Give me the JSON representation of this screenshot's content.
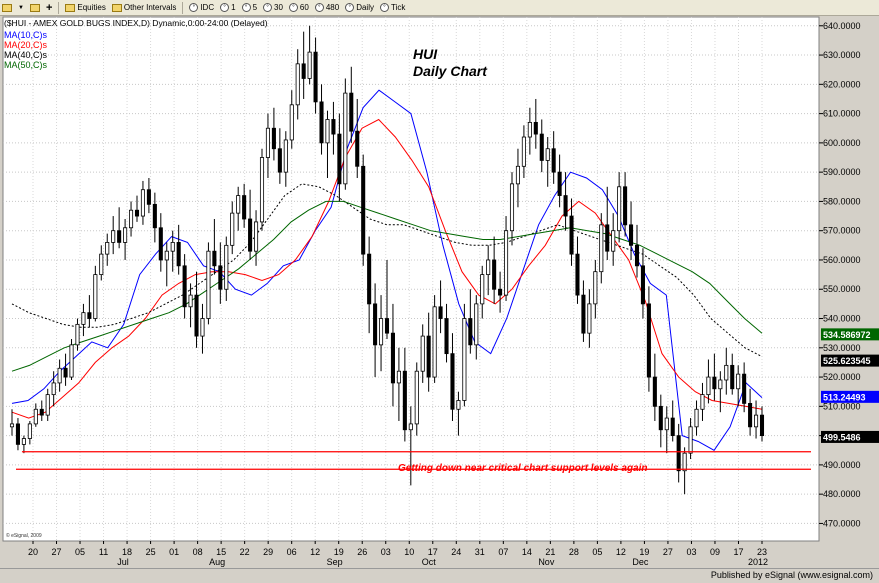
{
  "toolbar": {
    "items": [
      {
        "icon": "grid-icon",
        "label": ""
      },
      {
        "icon": "dropdown-arrow-icon",
        "label": ""
      },
      {
        "icon": "folder-icon",
        "label": ""
      },
      {
        "icon": "plus-icon",
        "label": ""
      },
      {
        "icon": "folder-icon",
        "label": "Equities"
      },
      {
        "icon": "folder-icon",
        "label": "Other Intervals"
      },
      {
        "icon": "circle-icon",
        "label": "IDC"
      },
      {
        "icon": "circle-icon",
        "label": "1"
      },
      {
        "icon": "circle-icon",
        "label": "5"
      },
      {
        "icon": "circle-icon",
        "label": "30"
      },
      {
        "icon": "circle-icon",
        "label": "60"
      },
      {
        "icon": "circle-icon",
        "label": "480"
      },
      {
        "icon": "circle-icon",
        "label": "Daily"
      },
      {
        "icon": "circle-icon",
        "label": "Tick"
      }
    ]
  },
  "footer": {
    "publisher": "Published by eSignal (www.esignal.com)"
  },
  "watermark": "© eSignal, 2009",
  "colors": {
    "price": "#000000",
    "ma10": "#0000ff",
    "ma20": "#ff0000",
    "ma40": "#000000",
    "ma50": "#006600",
    "support": "#ff0000",
    "plot_bg": "#ffffff"
  },
  "chart_data": {
    "type": "candlestick",
    "title": "HUI",
    "subtitle": "Daily Chart",
    "header": "($HUI - AMEX GOLD BUGS INDEX,D) Dynamic,0:00-24:00 (Delayed)",
    "legend": [
      {
        "name": "MA(10,C)s",
        "color": "#0000ff"
      },
      {
        "name": "MA(20,C)s",
        "color": "#ff0000"
      },
      {
        "name": "MA(40,C)s",
        "color": "#000000"
      },
      {
        "name": "MA(50,C)s",
        "color": "#006600"
      }
    ],
    "y_ticks": [
      "470.0000",
      "480.0000",
      "490.0000",
      "500.0000",
      "510.0000",
      "520.0000",
      "530.0000",
      "540.0000",
      "550.0000",
      "560.0000",
      "570.0000",
      "580.0000",
      "590.0000",
      "600.0000",
      "610.0000",
      "620.0000",
      "630.0000",
      "640.0000"
    ],
    "ylim": [
      464,
      643
    ],
    "x_tick_labels": [
      "20",
      "27",
      "05",
      "11",
      "18",
      "25",
      "01",
      "08",
      "15",
      "22",
      "29",
      "06",
      "12",
      "19",
      "26",
      "03",
      "10",
      "17",
      "24",
      "31",
      "07",
      "14",
      "21",
      "28",
      "05",
      "12",
      "19",
      "27",
      "03",
      "09",
      "17",
      "23"
    ],
    "month_labels": [
      {
        "label": "Jul",
        "at": 2
      },
      {
        "label": "Aug",
        "at": 6
      },
      {
        "label": "Sep",
        "at": 11
      },
      {
        "label": "Oct",
        "at": 15
      },
      {
        "label": "Nov",
        "at": 20
      },
      {
        "label": "Dec",
        "at": 24
      },
      {
        "label": "2012",
        "at": 29
      }
    ],
    "value_badges": [
      {
        "value": "534.586972",
        "color": "#006600"
      },
      {
        "value": "525.623545",
        "color": "#000000"
      },
      {
        "value": "513.24493",
        "color": "#0000ff"
      },
      {
        "value": "499.5486",
        "color": "#000000"
      }
    ],
    "ma_series": [
      {
        "name": "MA(10,C)s",
        "color": "#0000ff",
        "dash": false,
        "values": [
          511,
          512,
          516,
          522,
          527,
          532,
          530,
          538,
          555,
          562,
          568,
          566,
          558,
          556,
          550,
          548,
          552,
          558,
          560,
          570,
          578,
          598,
          612,
          618,
          614,
          610,
          590,
          565,
          545,
          532,
          528,
          540,
          556,
          572,
          582,
          590,
          588,
          584,
          575,
          562,
          552,
          548,
          500,
          498,
          495,
          503,
          518,
          513
        ],
        "note": "weekly samples"
      },
      {
        "name": "MA(20,C)s",
        "color": "#ff0000",
        "dash": false,
        "values": [
          508,
          506,
          508,
          513,
          518,
          525,
          530,
          534,
          540,
          548,
          552,
          555,
          556,
          556,
          555,
          553,
          555,
          560,
          568,
          580,
          595,
          605,
          608,
          602,
          594,
          585,
          570,
          556,
          548,
          545,
          550,
          558,
          565,
          575,
          580,
          576,
          568,
          560,
          546,
          528,
          520,
          515,
          512,
          511,
          510,
          509
        ]
      },
      {
        "name": "MA(40,C)s",
        "color": "#000000",
        "dash": true,
        "values": [
          545,
          542,
          540,
          538,
          537,
          537,
          538,
          540,
          542,
          545,
          548,
          552,
          556,
          560,
          566,
          574,
          582,
          586,
          585,
          582,
          578,
          574,
          572,
          572,
          570,
          568,
          566,
          565,
          565,
          566,
          568,
          570,
          572,
          570,
          568,
          566,
          564,
          562,
          558,
          554,
          548,
          540,
          535,
          530,
          527
        ]
      },
      {
        "name": "MA(50,C)s",
        "color": "#006600",
        "dash": false,
        "values": [
          522,
          524,
          527,
          530,
          532,
          534,
          536,
          538,
          540,
          542,
          545,
          549,
          553,
          557,
          562,
          567,
          573,
          577,
          580,
          580,
          578,
          576,
          574,
          572,
          570,
          569,
          568,
          567,
          567,
          568,
          569,
          570,
          571,
          570,
          569,
          567,
          565,
          562,
          559,
          556,
          552,
          546,
          540,
          535
        ]
      }
    ],
    "support_lines": [
      {
        "y": 494.5,
        "x_from_index": 1
      },
      {
        "y": 488.5,
        "x_from_index": 0
      }
    ],
    "annotation": "Getting down near critical chart support levels again",
    "candles": [
      [
        503,
        509,
        500,
        504
      ],
      [
        504,
        506,
        495,
        497
      ],
      [
        497,
        500,
        494,
        499
      ],
      [
        499,
        505,
        497,
        504
      ],
      [
        504,
        511,
        503,
        509
      ],
      [
        509,
        512,
        505,
        507
      ],
      [
        507,
        516,
        505,
        514
      ],
      [
        514,
        522,
        510,
        518
      ],
      [
        518,
        526,
        515,
        523
      ],
      [
        523,
        528,
        517,
        520
      ],
      [
        520,
        533,
        519,
        531
      ],
      [
        531,
        540,
        529,
        538
      ],
      [
        538,
        545,
        534,
        542
      ],
      [
        542,
        548,
        537,
        540
      ],
      [
        540,
        558,
        539,
        555
      ],
      [
        555,
        565,
        553,
        562
      ],
      [
        562,
        569,
        558,
        566
      ],
      [
        566,
        575,
        562,
        570
      ],
      [
        570,
        578,
        564,
        566
      ],
      [
        566,
        574,
        560,
        571
      ],
      [
        571,
        580,
        568,
        577
      ],
      [
        577,
        582,
        573,
        575
      ],
      [
        575,
        587,
        572,
        584
      ],
      [
        584,
        588,
        576,
        579
      ],
      [
        579,
        583,
        566,
        571
      ],
      [
        571,
        576,
        556,
        560
      ],
      [
        560,
        566,
        551,
        563
      ],
      [
        563,
        570,
        556,
        566
      ],
      [
        566,
        572,
        555,
        558
      ],
      [
        558,
        562,
        540,
        544
      ],
      [
        544,
        552,
        537,
        548
      ],
      [
        548,
        556,
        530,
        534
      ],
      [
        534,
        545,
        528,
        540
      ],
      [
        540,
        566,
        538,
        563
      ],
      [
        563,
        574,
        555,
        558
      ],
      [
        558,
        566,
        545,
        550
      ],
      [
        550,
        568,
        546,
        565
      ],
      [
        565,
        580,
        562,
        576
      ],
      [
        576,
        585,
        570,
        582
      ],
      [
        582,
        586,
        571,
        574
      ],
      [
        574,
        584,
        560,
        563
      ],
      [
        563,
        577,
        558,
        573
      ],
      [
        573,
        598,
        570,
        595
      ],
      [
        595,
        610,
        588,
        605
      ],
      [
        605,
        612,
        594,
        598
      ],
      [
        598,
        605,
        586,
        590
      ],
      [
        590,
        604,
        585,
        601
      ],
      [
        601,
        618,
        598,
        613
      ],
      [
        613,
        632,
        608,
        627
      ],
      [
        627,
        638,
        615,
        622
      ],
      [
        622,
        640,
        620,
        631
      ],
      [
        631,
        636,
        610,
        614
      ],
      [
        614,
        620,
        596,
        600
      ],
      [
        600,
        611,
        588,
        608
      ],
      [
        608,
        614,
        596,
        603
      ],
      [
        603,
        610,
        580,
        586
      ],
      [
        586,
        622,
        584,
        617
      ],
      [
        617,
        626,
        600,
        604
      ],
      [
        604,
        615,
        588,
        592
      ],
      [
        592,
        596,
        558,
        562
      ],
      [
        562,
        568,
        535,
        545
      ],
      [
        545,
        552,
        520,
        531
      ],
      [
        531,
        548,
        522,
        540
      ],
      [
        540,
        560,
        533,
        535
      ],
      [
        535,
        545,
        510,
        518
      ],
      [
        518,
        530,
        505,
        522
      ],
      [
        522,
        530,
        498,
        502
      ],
      [
        502,
        510,
        483,
        504
      ],
      [
        504,
        525,
        500,
        522
      ],
      [
        522,
        538,
        518,
        534
      ],
      [
        534,
        542,
        515,
        520
      ],
      [
        520,
        548,
        518,
        544
      ],
      [
        544,
        553,
        535,
        540
      ],
      [
        540,
        545,
        525,
        528
      ],
      [
        528,
        535,
        505,
        509
      ],
      [
        509,
        515,
        500,
        512
      ],
      [
        512,
        545,
        510,
        540
      ],
      [
        540,
        550,
        528,
        531
      ],
      [
        531,
        548,
        526,
        545
      ],
      [
        545,
        558,
        540,
        555
      ],
      [
        555,
        565,
        548,
        560
      ],
      [
        560,
        568,
        545,
        550
      ],
      [
        550,
        556,
        542,
        548
      ],
      [
        548,
        575,
        546,
        570
      ],
      [
        570,
        590,
        565,
        586
      ],
      [
        586,
        598,
        578,
        592
      ],
      [
        592,
        606,
        588,
        602
      ],
      [
        602,
        612,
        596,
        607
      ],
      [
        607,
        615,
        598,
        603
      ],
      [
        603,
        608,
        590,
        594
      ],
      [
        594,
        602,
        585,
        598
      ],
      [
        598,
        604,
        586,
        590
      ],
      [
        590,
        596,
        578,
        582
      ],
      [
        582,
        590,
        570,
        575
      ],
      [
        575,
        581,
        558,
        562
      ],
      [
        562,
        568,
        545,
        548
      ],
      [
        548,
        553,
        532,
        535
      ],
      [
        535,
        550,
        530,
        545
      ],
      [
        545,
        560,
        540,
        556
      ],
      [
        556,
        576,
        552,
        572
      ],
      [
        572,
        585,
        560,
        563
      ],
      [
        563,
        576,
        558,
        570
      ],
      [
        570,
        590,
        566,
        585
      ],
      [
        585,
        590,
        568,
        572
      ],
      [
        572,
        580,
        560,
        565
      ],
      [
        565,
        572,
        554,
        558
      ],
      [
        558,
        564,
        540,
        545
      ],
      [
        545,
        551,
        515,
        520
      ],
      [
        520,
        528,
        505,
        510
      ],
      [
        510,
        514,
        496,
        502
      ],
      [
        502,
        510,
        494,
        506
      ],
      [
        506,
        512,
        498,
        500
      ],
      [
        500,
        504,
        484,
        488
      ],
      [
        488,
        496,
        480,
        494
      ],
      [
        494,
        506,
        492,
        503
      ],
      [
        503,
        512,
        500,
        509
      ],
      [
        509,
        518,
        505,
        514
      ],
      [
        514,
        526,
        511,
        520
      ],
      [
        520,
        528,
        512,
        516
      ],
      [
        516,
        522,
        508,
        519
      ],
      [
        519,
        530,
        514,
        524
      ],
      [
        524,
        528,
        514,
        516
      ],
      [
        516,
        524,
        510,
        521
      ],
      [
        521,
        525,
        508,
        511
      ],
      [
        511,
        516,
        500,
        503
      ],
      [
        503,
        512,
        499,
        507
      ],
      [
        507,
        510,
        498,
        500
      ]
    ]
  }
}
